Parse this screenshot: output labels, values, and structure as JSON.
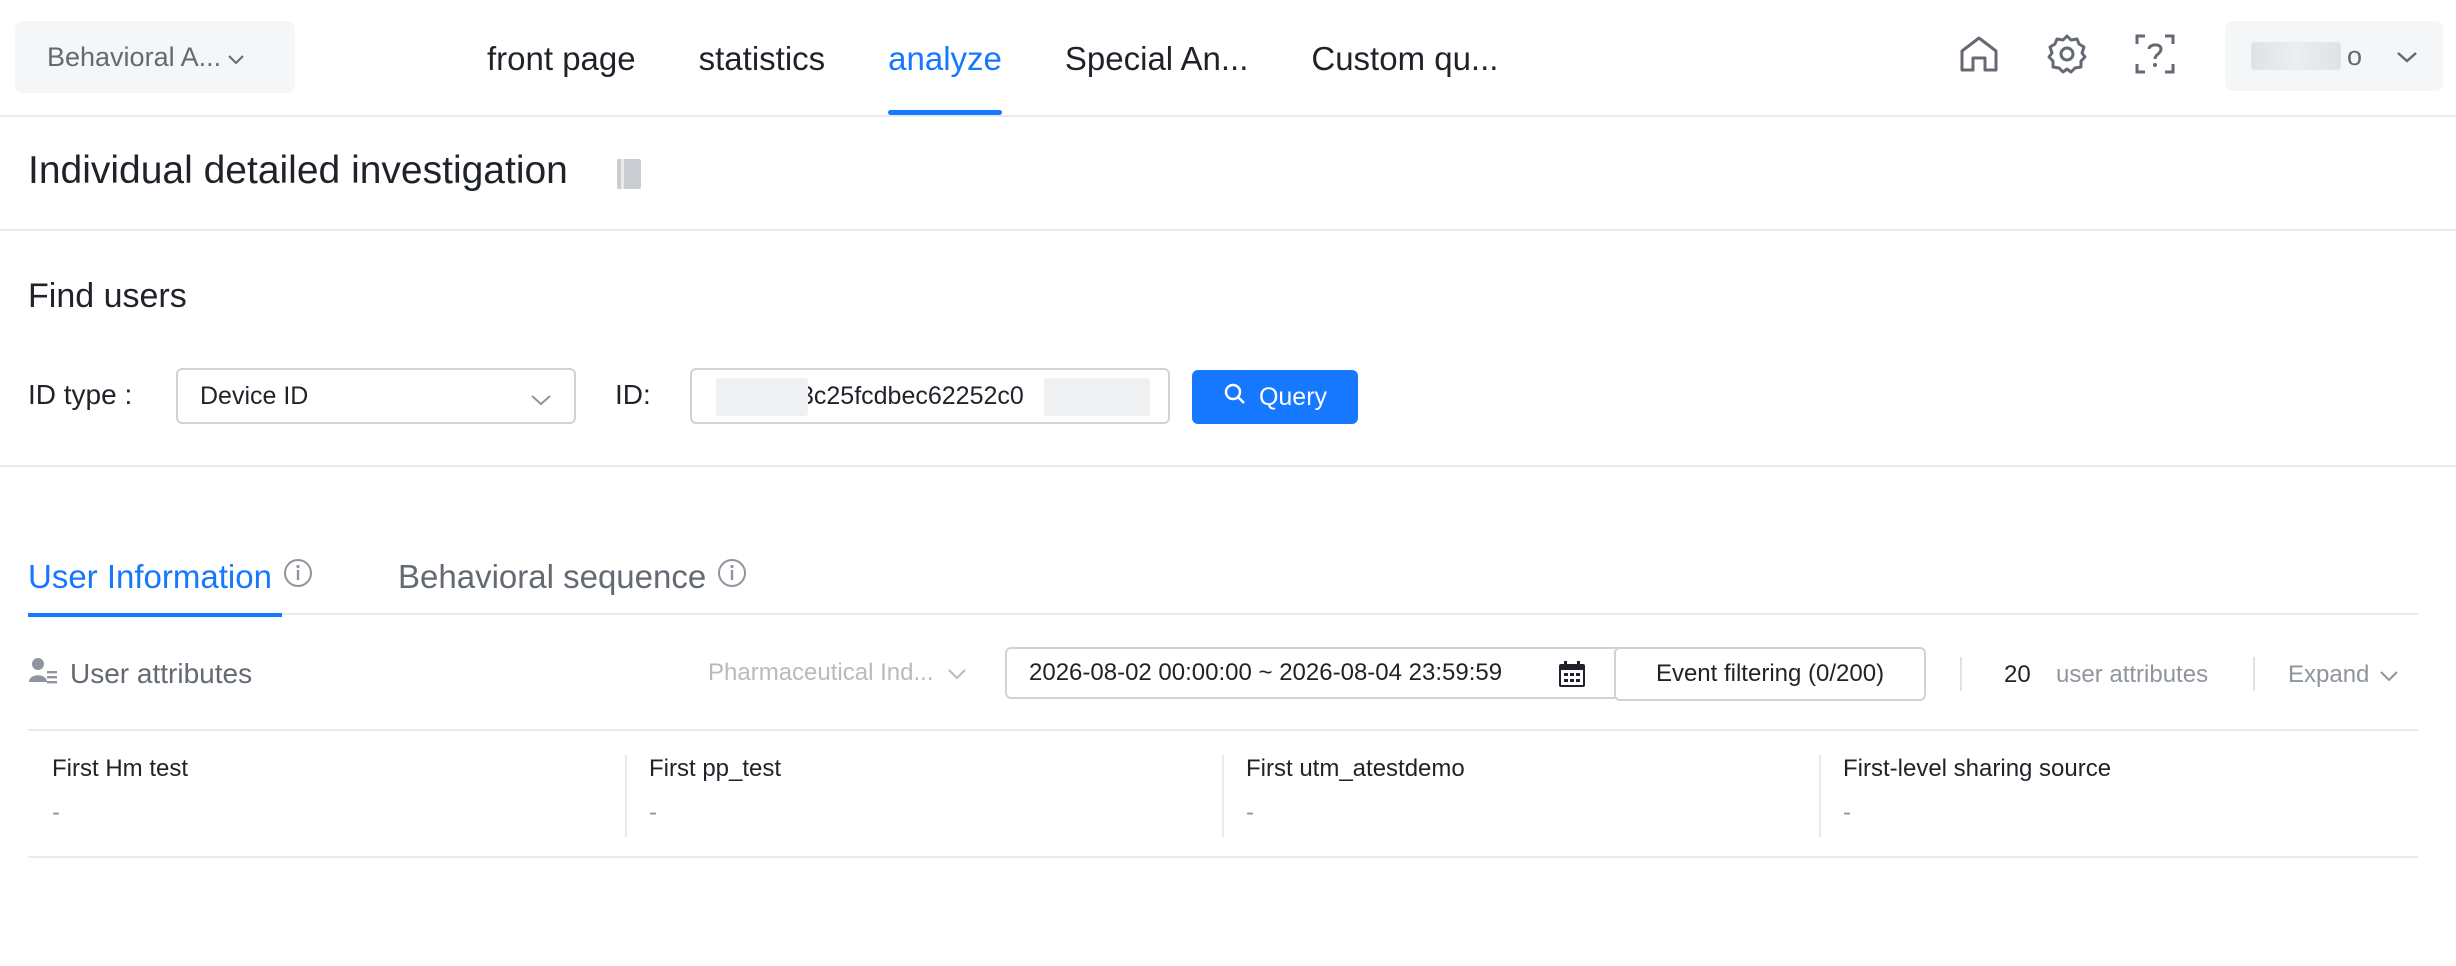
{
  "app_switcher": {
    "label": "Behavioral A..."
  },
  "nav": {
    "tabs": [
      {
        "label": "front page",
        "active": false
      },
      {
        "label": "statistics",
        "active": false
      },
      {
        "label": "analyze",
        "active": true
      },
      {
        "label": "Special An...",
        "active": false
      },
      {
        "label": "Custom qu...",
        "active": false
      }
    ]
  },
  "header_icons": [
    "home-icon",
    "settings-icon",
    "help-icon"
  ],
  "user": {
    "name_suffix": "o"
  },
  "page": {
    "title": "Individual detailed investigation"
  },
  "find_users": {
    "title": "Find users",
    "id_type_label": "ID type :",
    "id_type_value": "Device ID",
    "id_label": "ID:",
    "id_value": "3c25fcdbec62252c0",
    "query_label": "Query"
  },
  "info_tabs": [
    {
      "label": "User Information",
      "active": true
    },
    {
      "label": "Behavioral sequence",
      "active": false
    }
  ],
  "attr_toolbar": {
    "label": "User attributes",
    "group_placeholder": "Pharmaceutical Ind...",
    "date_range": "2026-08-02 00:00:00 ~ 2026-08-04 23:59:59",
    "event_filter": "Event filtering (0/200)",
    "count": "20",
    "count_label": "user attributes",
    "expand_label": "Expand"
  },
  "attributes": [
    {
      "name": "First Hm test",
      "value": "-"
    },
    {
      "name": "First pp_test",
      "value": "-"
    },
    {
      "name": "First utm_atestdemo",
      "value": "-"
    },
    {
      "name": "First-level sharing source",
      "value": "-"
    }
  ],
  "colors": {
    "accent": "#1677ff",
    "text": "#1f2329",
    "muted": "#646a73",
    "border": "#e8eaed"
  }
}
